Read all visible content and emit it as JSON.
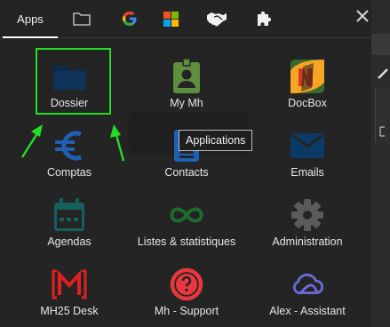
{
  "tabs": {
    "apps_label": "Apps"
  },
  "apps": [
    {
      "label": "Dossier",
      "icon": "folder-icon",
      "color": "#0d2a4a"
    },
    {
      "label": "My Mh",
      "icon": "id-badge-icon",
      "color": "#5f8f3e"
    },
    {
      "label": "DocBox",
      "icon": "docbox-logo-icon",
      "color": "#f5a623"
    },
    {
      "label": "Comptas",
      "icon": "euro-icon",
      "color": "#1f5fb4"
    },
    {
      "label": "Contacts",
      "icon": "contacts-icon",
      "color": "#1f5fb4"
    },
    {
      "label": "Emails",
      "icon": "envelope-icon",
      "color": "#0b3a66"
    },
    {
      "label": "Agendas",
      "icon": "calendar-icon",
      "color": "#15605e"
    },
    {
      "label": "Listes & statistiques",
      "icon": "infinity-icon",
      "color": "#1f6b2e"
    },
    {
      "label": "Administration",
      "icon": "gear-icon",
      "color": "#5a5a5a"
    },
    {
      "label": "MH25 Desk",
      "icon": "mh25-logo-icon",
      "color": "#e02020"
    },
    {
      "label": "Mh - Support",
      "icon": "help-icon",
      "color": "#e8383d"
    },
    {
      "label": "Alex - Assistant",
      "icon": "cloud-icon",
      "color": "#6a6ad8"
    }
  ],
  "tooltip": {
    "text": "Applications"
  },
  "colors": {
    "highlight": "#22dd22",
    "panel": "#242424"
  }
}
